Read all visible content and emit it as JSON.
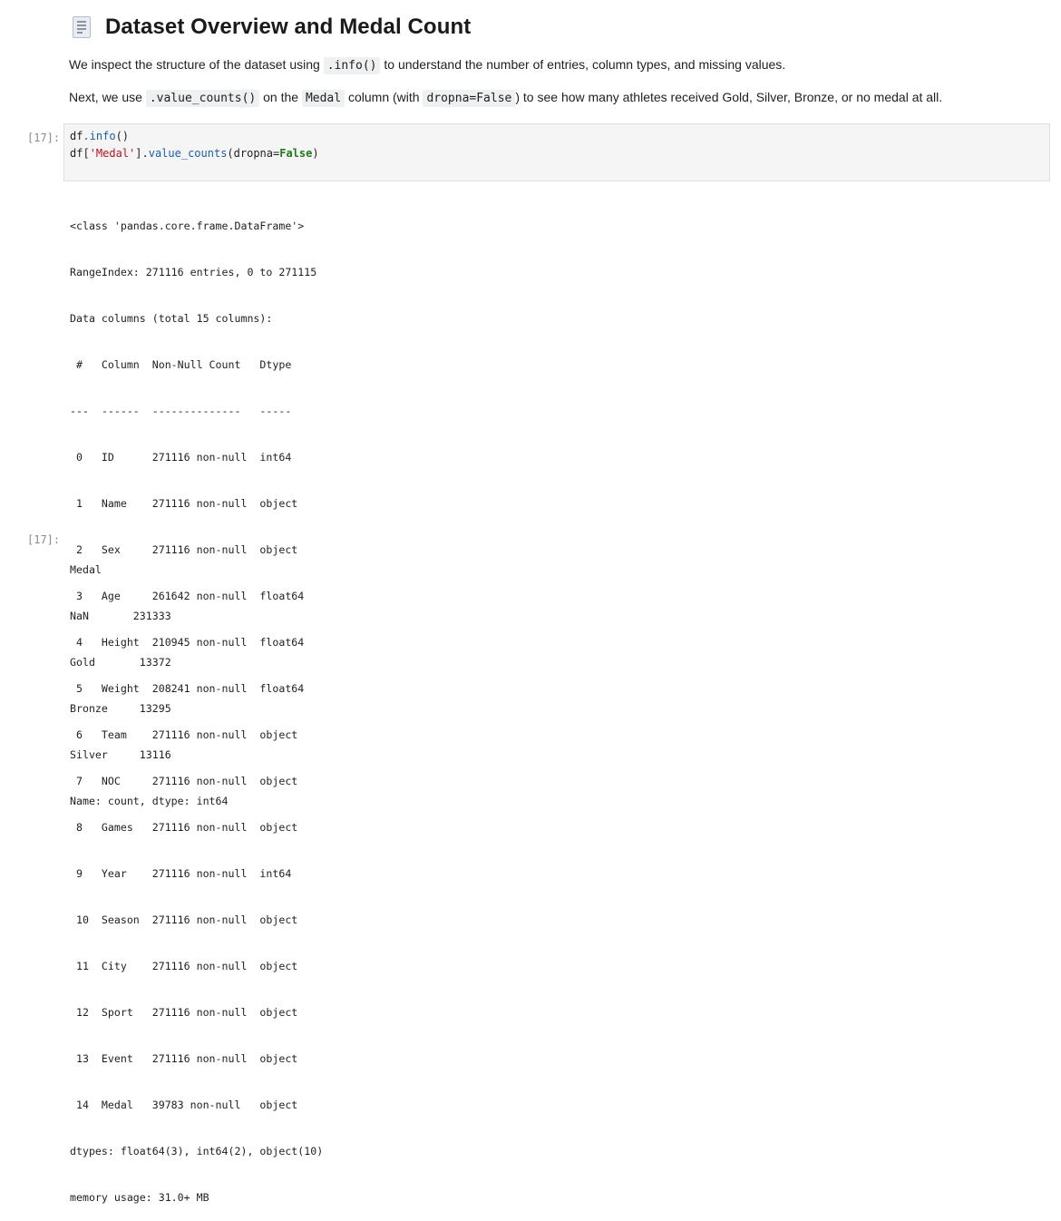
{
  "markdown": {
    "title": "Dataset Overview and Medal Count",
    "p1": {
      "before": "We inspect the structure of the dataset using ",
      "code": ".info()",
      "after": " to understand the number of entries, column types, and missing values."
    },
    "p2": {
      "before": "Next, we use ",
      "code1": ".value_counts()",
      "mid1": " on the ",
      "code2": "Medal",
      "mid2": " column (with ",
      "code3": "dropna=False",
      "after": ") to see how many athletes received Gold, Silver, Bronze, or no medal at all."
    }
  },
  "code_cell": {
    "prompt": "[17]:",
    "line1": {
      "obj": "df",
      "attr": ".info",
      "rest": "()"
    },
    "line2": {
      "obj": "df[",
      "str": "'Medal'",
      "mid": "].",
      "attr": "value_counts",
      "open": "(dropna=",
      "kw": "False",
      "close": ")"
    }
  },
  "info_output": {
    "lines": [
      "<class 'pandas.core.frame.DataFrame'>",
      "RangeIndex: 271116 entries, 0 to 271115",
      "Data columns (total 15 columns):",
      " #   Column  Non-Null Count   Dtype  ",
      "---  ------  --------------   -----  ",
      " 0   ID      271116 non-null  int64  ",
      " 1   Name    271116 non-null  object ",
      " 2   Sex     271116 non-null  object ",
      " 3   Age     261642 non-null  float64",
      " 4   Height  210945 non-null  float64",
      " 5   Weight  208241 non-null  float64",
      " 6   Team    271116 non-null  object ",
      " 7   NOC     271116 non-null  object ",
      " 8   Games   271116 non-null  object ",
      " 9   Year    271116 non-null  int64  ",
      " 10  Season  271116 non-null  object ",
      " 11  City    271116 non-null  object ",
      " 12  Sport   271116 non-null  object ",
      " 13  Event   271116 non-null  object ",
      " 14  Medal   39783 non-null   object ",
      "dtypes: float64(3), int64(2), object(10)",
      "memory usage: 31.0+ MB"
    ]
  },
  "result_output": {
    "prompt": "[17]:",
    "lines": [
      "Medal",
      "NaN       231333",
      "Gold       13372",
      "Bronze     13295",
      "Silver     13116",
      "Name: count, dtype: int64"
    ]
  }
}
